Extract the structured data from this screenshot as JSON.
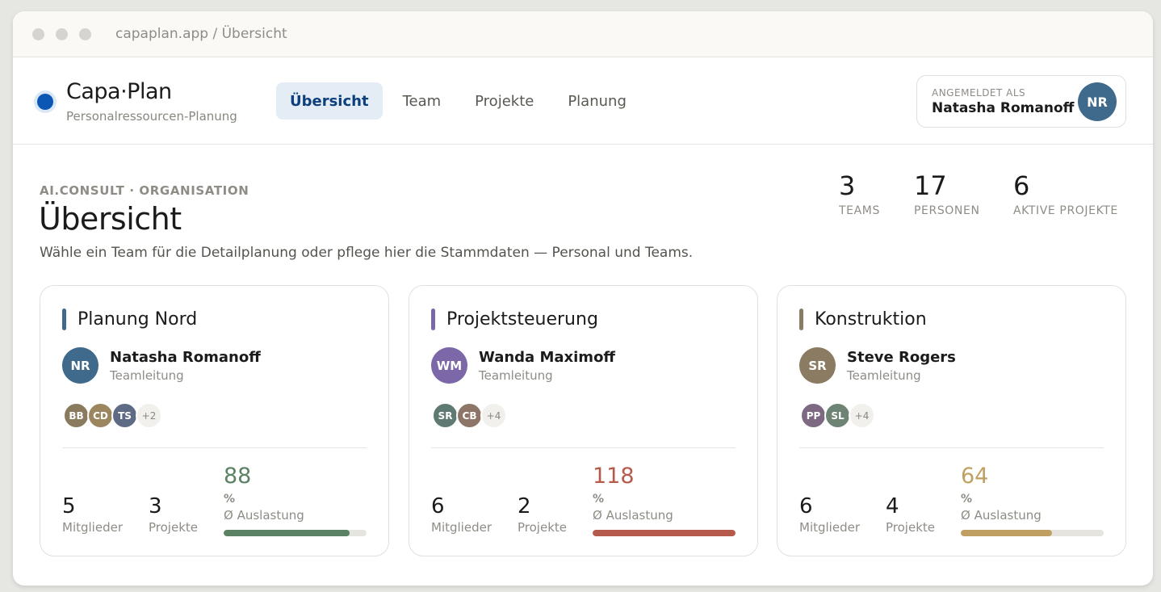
{
  "window": {
    "url": "capaplan.app / Übersicht"
  },
  "brand": {
    "name": "Capa·Plan",
    "subtitle": "Personalressourcen-Planung",
    "accent": "#0d57b4"
  },
  "nav": [
    {
      "label": "Übersicht",
      "active": true
    },
    {
      "label": "Team",
      "active": false
    },
    {
      "label": "Projekte",
      "active": false
    },
    {
      "label": "Planung",
      "active": false
    }
  ],
  "user": {
    "label": "ANGEMELDET ALS",
    "name": "Natasha Romanoff",
    "initials": "NR",
    "color": "#3f6a8c"
  },
  "page": {
    "eyebrow": "AI.CONSULT · ORGANISATION",
    "title": "Übersicht",
    "subtitle": "Wähle ein Team für die Detailplanung oder pflege hier die Stammdaten — Personal und Teams."
  },
  "stats": [
    {
      "value": "3",
      "label": "TEAMS"
    },
    {
      "value": "17",
      "label": "PERSONEN"
    },
    {
      "value": "6",
      "label": "AKTIVE PROJEKTE"
    }
  ],
  "teams": [
    {
      "name": "Planung Nord",
      "color": "#3f6a8c",
      "lead": {
        "name": "Natasha Romanoff",
        "role": "Teamleitung",
        "initials": "NR",
        "color": "#3f6a8c"
      },
      "members": [
        {
          "initials": "BB",
          "color": "#8a7a5e"
        },
        {
          "initials": "CD",
          "color": "#9b8660"
        },
        {
          "initials": "TS",
          "color": "#5f6b84"
        }
      ],
      "more": "+2",
      "members_count": "5",
      "members_label": "Mitglieder",
      "projects_count": "3",
      "projects_label": "Projekte",
      "utilization": "88",
      "utilization_value": 88,
      "pct": "%",
      "util_label": "Ø Auslastung",
      "util_color": "#5b8264"
    },
    {
      "name": "Projektsteuerung",
      "color": "#7c68a8",
      "lead": {
        "name": "Wanda Maximoff",
        "role": "Teamleitung",
        "initials": "WM",
        "color": "#7c68a8"
      },
      "members": [
        {
          "initials": "SR",
          "color": "#5f7a72"
        },
        {
          "initials": "CB",
          "color": "#8d7568"
        }
      ],
      "more": "+4",
      "members_count": "6",
      "members_label": "Mitglieder",
      "projects_count": "2",
      "projects_label": "Projekte",
      "utilization": "118",
      "utilization_value": 118,
      "pct": "%",
      "util_label": "Ø Auslastung",
      "util_color": "#b65b4b"
    },
    {
      "name": "Konstruktion",
      "color": "#8b7b62",
      "lead": {
        "name": "Steve Rogers",
        "role": "Teamleitung",
        "initials": "SR",
        "color": "#8b7b62"
      },
      "members": [
        {
          "initials": "PP",
          "color": "#7d6a82"
        },
        {
          "initials": "SL",
          "color": "#6d8373"
        }
      ],
      "more": "+4",
      "members_count": "6",
      "members_label": "Mitglieder",
      "projects_count": "4",
      "projects_label": "Projekte",
      "utilization": "64",
      "utilization_value": 64,
      "pct": "%",
      "util_label": "Ø Auslastung",
      "util_color": "#c0a062"
    }
  ]
}
